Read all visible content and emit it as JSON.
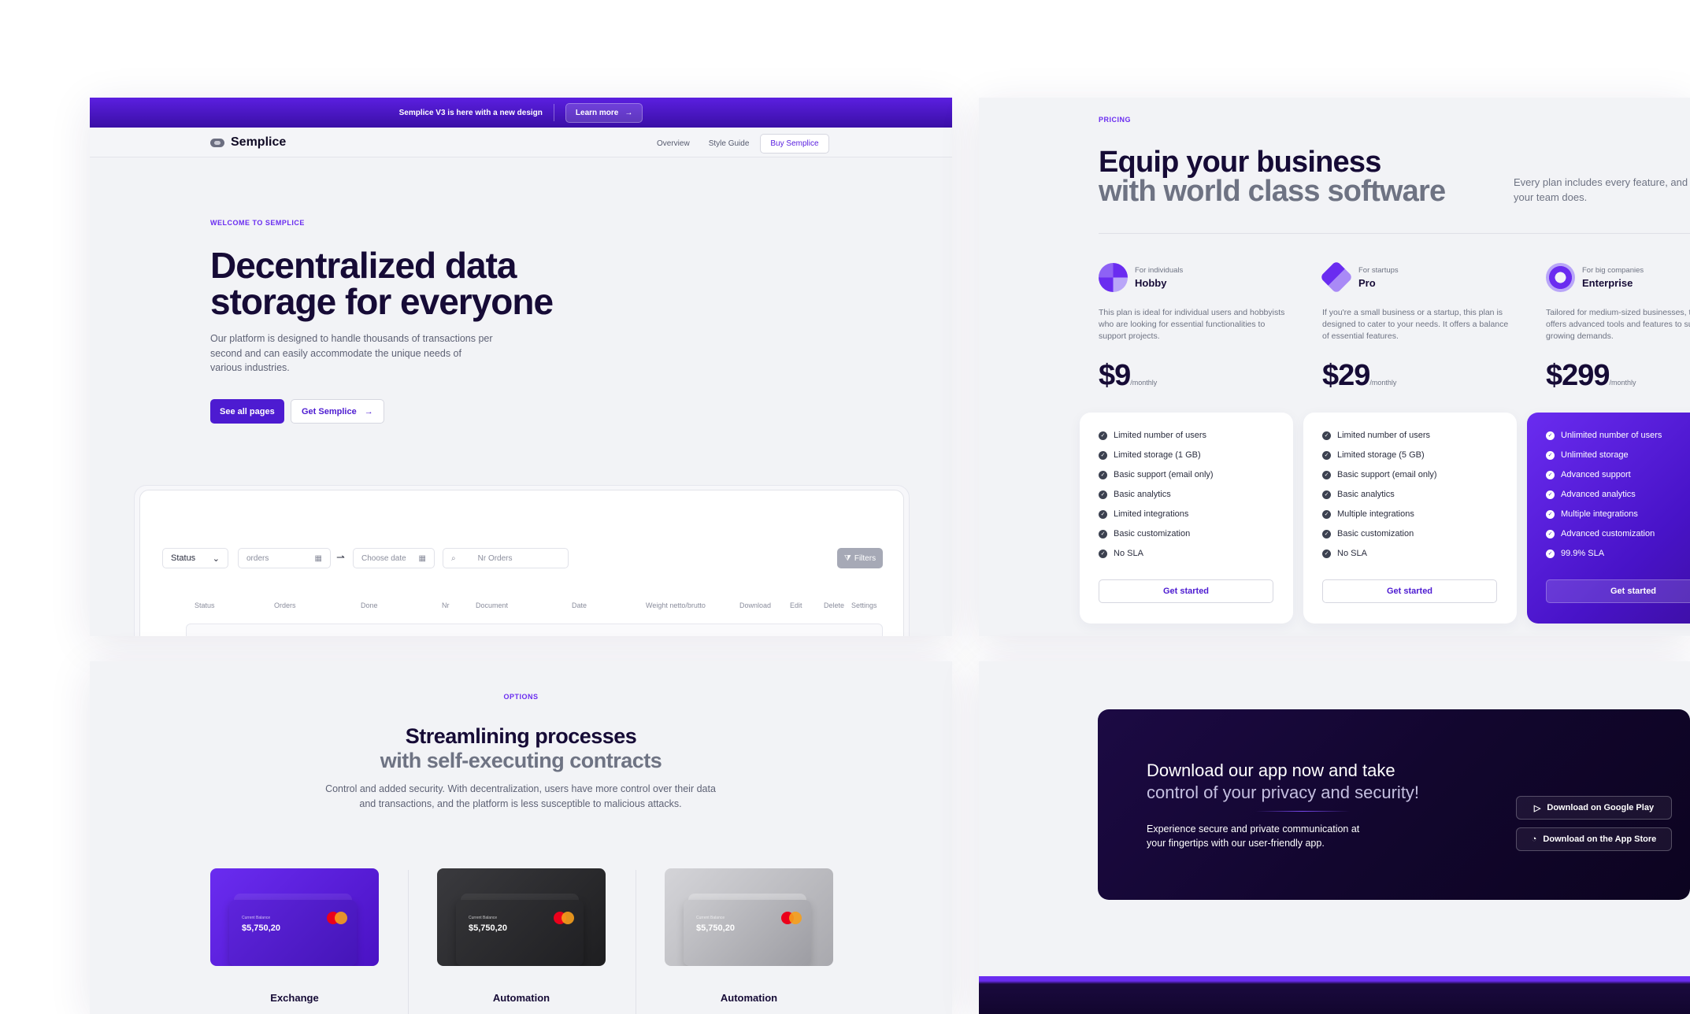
{
  "hero": {
    "banner_text": "Semplice V3 is here with a new design",
    "banner_button": "Learn more",
    "brand": "Semplice",
    "nav": [
      "Overview",
      "Style Guide",
      "Buy Semplice"
    ],
    "eyebrow": "WELCOME TO SEMPLICE",
    "title_line1": "Decentralized data",
    "title_line2": "storage for everyone",
    "lead": "Our platform is designed to handle thousands of transactions per second and can easily accommodate the unique needs of various industries.",
    "cta_primary": "See all pages",
    "cta_secondary": "Get Semplice",
    "dashboard": {
      "status_select": "Status",
      "orders_placeholder": "orders",
      "date_placeholder": "Choose date",
      "search_placeholder": "Nr Orders",
      "filters": "Filters",
      "columns": [
        "Status",
        "Orders",
        "Done",
        "Nr",
        "Document",
        "Date",
        "Weight netto/brutto",
        "Download",
        "Edit",
        "Delete",
        "Settings"
      ]
    }
  },
  "pricing": {
    "eyebrow": "PRICING",
    "title_line1": "Equip your business",
    "title_line2": "with world class software",
    "side_text": "Every plan includes every feature, and can scale as your team does.",
    "plans": [
      {
        "audience": "For individuals",
        "name": "Hobby",
        "description": "This plan is ideal for individual users and hobbyists who are looking for essential functionalities to support projects.",
        "price": "$9",
        "period": "/monthly",
        "features": [
          "Limited number of users",
          "Limited storage (1 GB)",
          "Basic support (email only)",
          "Basic analytics",
          "Limited integrations",
          "Basic customization",
          "No SLA"
        ],
        "button": "Get started"
      },
      {
        "audience": "For startups",
        "name": "Pro",
        "description": "If you're a small business or a startup, this plan is designed to cater to your needs. It offers a balance of essential features.",
        "price": "$29",
        "period": "/monthly",
        "features": [
          "Limited number of users",
          "Limited storage (5 GB)",
          "Basic support (email only)",
          "Basic analytics",
          "Multiple integrations",
          "Basic customization",
          "No SLA"
        ],
        "button": "Get started"
      },
      {
        "audience": "For big companies",
        "name": "Enterprise",
        "description": "Tailored for medium-sized businesses, this plan offers advanced tools and features to support your growing demands.",
        "price": "$299",
        "period": "/monthly",
        "features": [
          "Unlimited number of users",
          "Unlimited storage",
          "Advanced support",
          "Advanced analytics",
          "Multiple integrations",
          "Advanced customization",
          "99.9% SLA"
        ],
        "button": "Get started"
      }
    ]
  },
  "options": {
    "eyebrow": "OPTIONS",
    "title_line1": "Streamlining processes",
    "title_line2": "with self-executing contracts",
    "lead": "Control and added security. With decentralization, users have more control over their data and transactions, and the platform is less susceptible to malicious attacks.",
    "cards": [
      {
        "label": "Current Balance",
        "balance": "$5,750,20",
        "name": "Exchange",
        "theme": "#5a22e0"
      },
      {
        "label": "Current Balance",
        "balance": "$5,750,20",
        "name": "Automation",
        "theme": "#2b2b2e"
      },
      {
        "label": "Current Balance",
        "balance": "$5,750,20",
        "name": "Automation",
        "theme": "#bfbfc4"
      }
    ]
  },
  "download": {
    "title_line1": "Download our app now and take",
    "title_line2": "control of your privacy and security!",
    "lead": "Experience secure and private communication at your fingertips with our user-friendly app.",
    "google_play": "Download on Google Play",
    "app_store": "Download on the App Store"
  },
  "colors": {
    "accent": "#4d1bd1",
    "brand_purple": "#6a2cf0",
    "dark": "#160b36"
  }
}
